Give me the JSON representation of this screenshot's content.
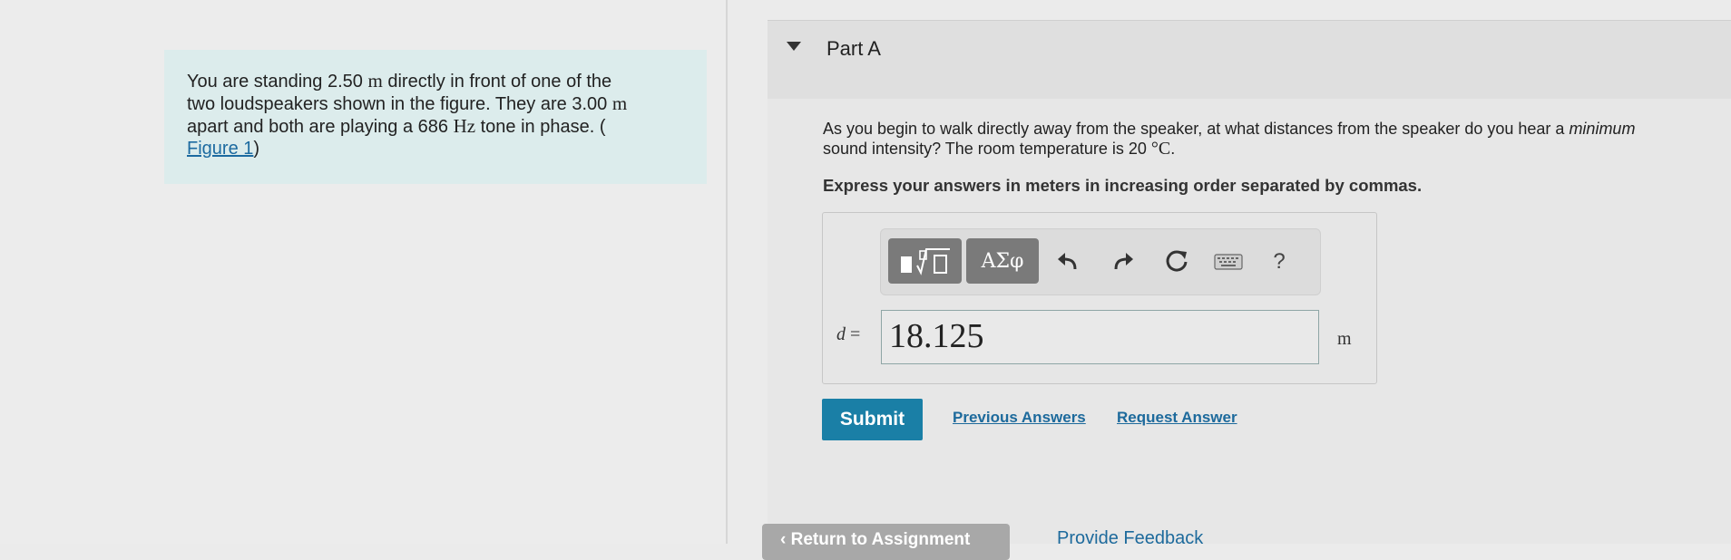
{
  "problem": {
    "line1_a": "You are standing 2.50 ",
    "line1_unit": "m",
    "line1_b": " directly in front of one of the",
    "line2_a": "two loudspeakers shown in the figure. They are 3.00 ",
    "line2_unit": "m",
    "line3_a": "apart and both are playing a 686 ",
    "line3_unit": "Hz",
    "line3_b": " tone in phase. (",
    "figure_link": "Figure 1",
    "line4_close": ")"
  },
  "part": {
    "title": "Part A"
  },
  "question": {
    "text_a": "As you begin to walk directly away from the speaker, at what distances from the speaker do you hear a ",
    "text_em": "minimum",
    "text_b": "sound intensity? The room temperature is 20 ",
    "temp_unit": "°C",
    "text_end": ".",
    "instruction": "Express your answers in meters in increasing order separated by commas."
  },
  "toolbar": {
    "greek_label": "ΑΣφ",
    "help_label": "?",
    "icons": [
      "templates-icon",
      "greek-letters-icon",
      "undo-icon",
      "redo-icon",
      "reset-icon",
      "keyboard-icon",
      "help-icon"
    ]
  },
  "answer": {
    "variable": "d",
    "equals": " =",
    "value": "18.125",
    "unit": "m"
  },
  "actions": {
    "submit_label": "Submit",
    "previous_answers": "Previous Answers",
    "request_answer": "Request Answer"
  },
  "footer": {
    "return_label": "‹ Return to Assignment",
    "feedback_label": "Provide Feedback"
  },
  "colors": {
    "problem_bg": "#dcecec",
    "submit_bg": "#1a7fa6",
    "link": "#1d6a9c"
  }
}
